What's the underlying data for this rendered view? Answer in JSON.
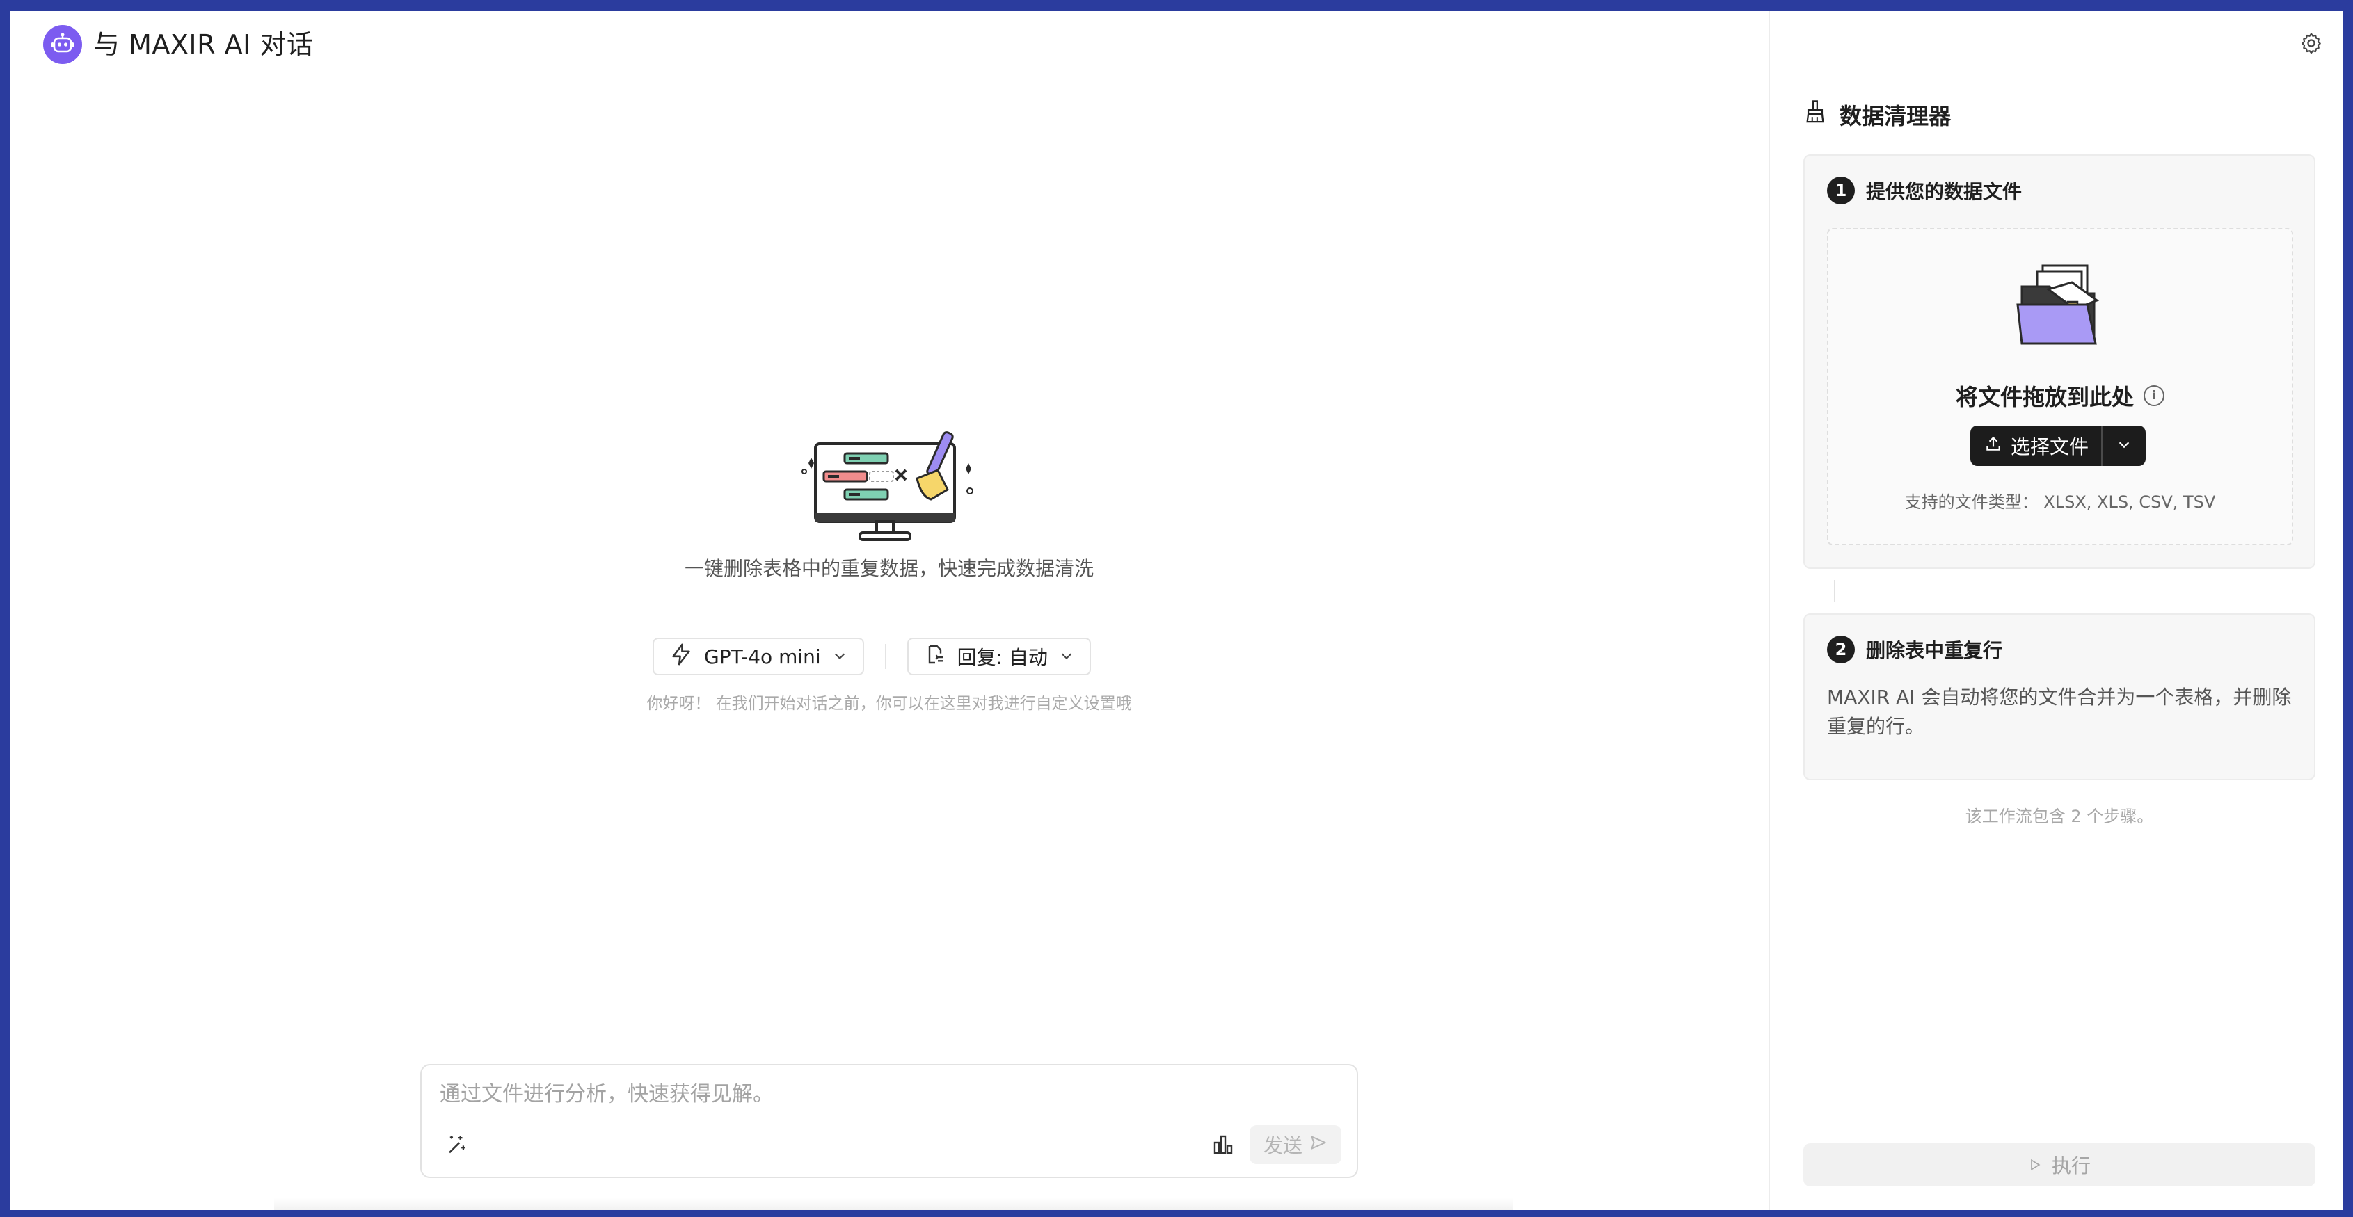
{
  "header": {
    "title": "与 MAXIR AI 对话",
    "logo_icon": "robot-icon"
  },
  "main": {
    "description": "一键删除表格中的重复数据，快速完成数据清洗",
    "model_selector": {
      "label": "GPT-4o mini",
      "icon": "lightning-icon"
    },
    "reply_selector": {
      "label": "回复: 自动",
      "icon": "reply-settings-icon"
    },
    "hint": "你好呀！ 在我们开始对话之前，你可以在这里对我进行自定义设置哦"
  },
  "chat": {
    "placeholder": "通过文件进行分析，快速获得见解。",
    "send_label": "发送"
  },
  "panel": {
    "title": "数据清理器",
    "step1": {
      "number": "1",
      "title": "提供您的数据文件",
      "drop_label": "将文件拖放到此处",
      "button_label": "选择文件",
      "supported_types": "支持的文件类型：  XLSX, XLS, CSV, TSV"
    },
    "step2": {
      "number": "2",
      "title": "删除表中重复行",
      "description": "MAXIR AI 会自动将您的文件合并为一个表格，并删除重复的行。"
    },
    "footnote": "该工作流包含 2 个步骤。",
    "run_label": "执行"
  },
  "colors": {
    "accent": "#7c5cf0",
    "frame": "#2b3c9e",
    "dark_button": "#1c1c1c"
  }
}
